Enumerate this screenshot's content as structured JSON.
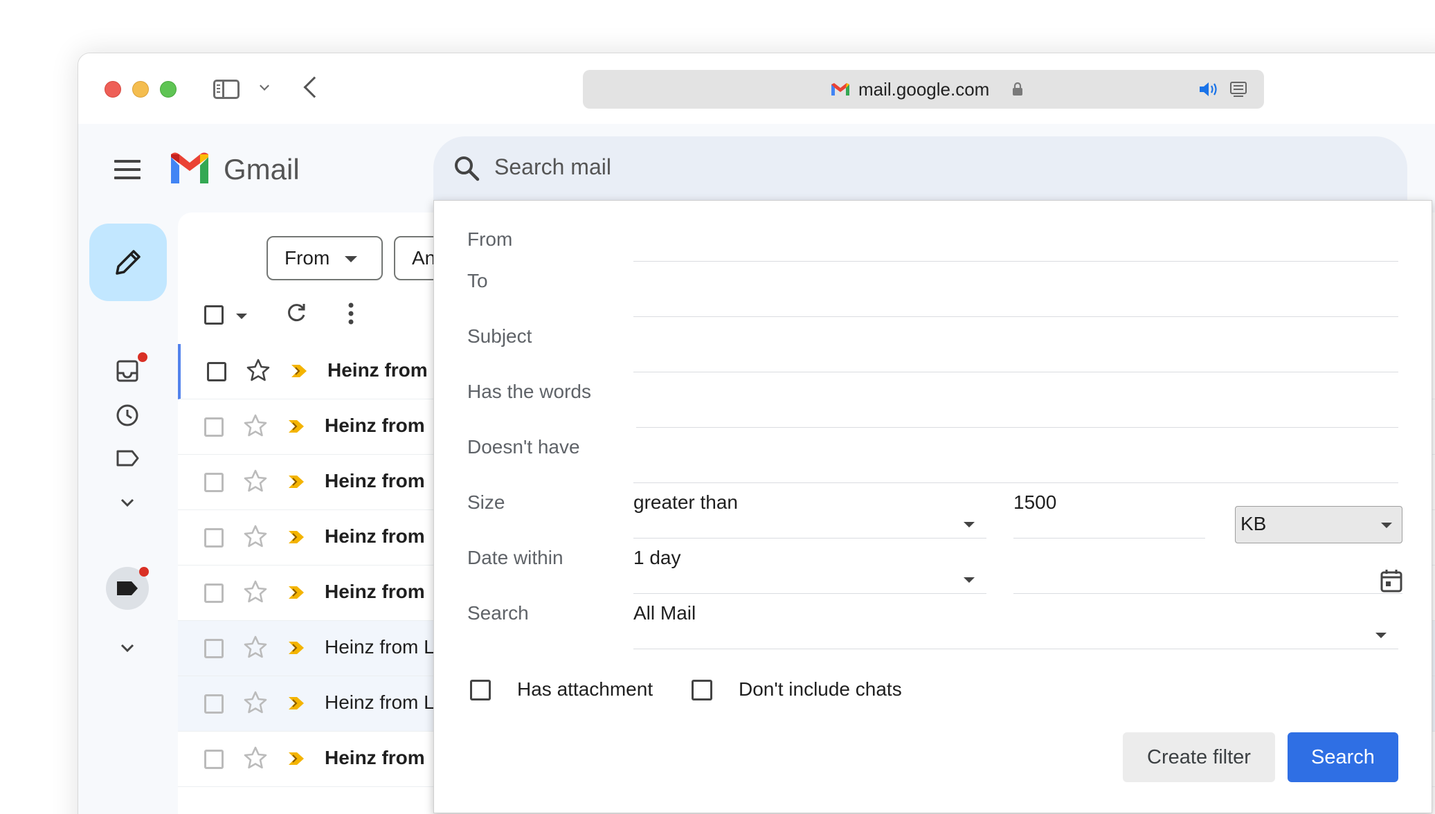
{
  "browser": {
    "url": "mail.google.com"
  },
  "gmail": {
    "title": "Gmail",
    "search_placeholder": "Search mail"
  },
  "filters": {
    "from_chip": "From",
    "time_chip": "Any time"
  },
  "emails": [
    {
      "sender": "Heinz from",
      "unread": true,
      "selected": true
    },
    {
      "sender": "Heinz from",
      "unread": true
    },
    {
      "sender": "Heinz from",
      "unread": true
    },
    {
      "sender": "Heinz from",
      "unread": true
    },
    {
      "sender": "Heinz from",
      "unread": true
    },
    {
      "sender": "Heinz from L",
      "unread": false
    },
    {
      "sender": "Heinz from L",
      "unread": false
    },
    {
      "sender": "Heinz from",
      "unread": true
    }
  ],
  "advanced_search": {
    "from_label": "From",
    "to_label": "To",
    "subject_label": "Subject",
    "has_words_label": "Has the words",
    "doesnt_have_label": "Doesn't have",
    "size_label": "Size",
    "size_operator": "greater than",
    "size_value": "1500",
    "size_unit": "KB",
    "date_label": "Date within",
    "date_value": "1 day",
    "search_label": "Search",
    "search_value": "All Mail",
    "has_attachment_label": "Has attachment",
    "dont_include_chats_label": "Don't include chats",
    "create_filter_label": "Create filter",
    "search_button_label": "Search"
  },
  "colors": {
    "accent": "#2f6fe4",
    "compose_bg": "#c2e7ff",
    "notification_dot": "#d93025",
    "important_marker": "#f4b400"
  },
  "icons": [
    "red-close-icon",
    "yellow-minimize-icon",
    "green-zoom-icon",
    "sidebar-toggle-icon",
    "back-arrow-icon",
    "lock-icon",
    "speaker-icon",
    "reader-icon",
    "hamburger-menu-icon",
    "search-icon",
    "pencil-icon",
    "inbox-icon",
    "clock-icon",
    "label-icon",
    "plus-icon",
    "refresh-icon",
    "more-vert-icon",
    "star-icon",
    "important-icon",
    "calendar-icon"
  ]
}
